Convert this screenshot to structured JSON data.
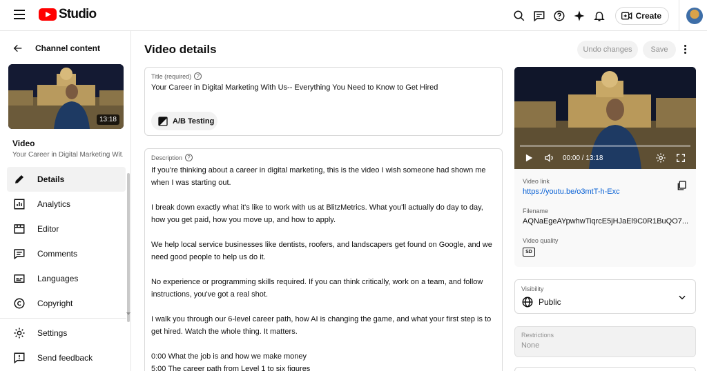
{
  "header": {
    "logo_text": "Studio",
    "create_label": "Create"
  },
  "sidebar": {
    "back_label": "Channel content",
    "thumbnail_duration": "13:18",
    "video_label": "Video",
    "video_title": "Your Career in Digital Marketing Wit...",
    "nav": [
      {
        "label": "Details",
        "icon": "pencil-icon"
      },
      {
        "label": "Analytics",
        "icon": "analytics-icon"
      },
      {
        "label": "Editor",
        "icon": "editor-icon"
      },
      {
        "label": "Comments",
        "icon": "comments-icon"
      },
      {
        "label": "Languages",
        "icon": "languages-icon"
      },
      {
        "label": "Copyright",
        "icon": "copyright-icon"
      }
    ],
    "bottom_nav": [
      {
        "label": "Settings",
        "icon": "gear-icon"
      },
      {
        "label": "Send feedback",
        "icon": "feedback-icon"
      }
    ]
  },
  "main": {
    "page_title": "Video details",
    "undo_label": "Undo changes",
    "save_label": "Save",
    "title_field": {
      "label": "Title (required)",
      "value": "Your Career in Digital Marketing With Us-- Everything You Need to Know to Get Hired"
    },
    "ab_testing_label": "A/B Testing",
    "description_field": {
      "label": "Description",
      "lines": [
        "If you're thinking about a career in digital marketing, this is the video I wish someone had shown me",
        "when I was starting out.",
        "",
        "I break down exactly what it's like to work with us at BlitzMetrics. What you'll actually do day to day,",
        "how you get paid, how you move up, and how to apply.",
        "",
        "We help local service businesses like dentists, roofers, and landscapers get found on Google, and we",
        "need good people to help us do it.",
        "",
        "No experience or programming skills required. If you can think critically, work on a team, and follow",
        "instructions, you've got a real shot.",
        "",
        "I walk you through our 6-level career path, how AI is changing the game, and what your first step is to",
        "get hired. Watch the whole thing. It matters.",
        "",
        "0:00 What the job is and how we make money",
        "5:00 The career path from Level 1 to six figures"
      ]
    }
  },
  "preview": {
    "time": "00:00 / 13:18",
    "video_link_label": "Video link",
    "video_link": "https://youtu.be/o3mtT-h-Exc",
    "filename_label": "Filename",
    "filename": "AQNaEgeAYpwhwTiqrcE5jHJaEl9C0R1BuQO7...",
    "quality_label": "Video quality",
    "quality_badge": "SD"
  },
  "visibility": {
    "label": "Visibility",
    "value": "Public"
  },
  "restrictions": {
    "label": "Restrictions",
    "value": "None"
  },
  "colors": {
    "brand_red": "#ff0000",
    "link_blue": "#065fd4",
    "active_nav_bg": "#f2f2f2"
  }
}
